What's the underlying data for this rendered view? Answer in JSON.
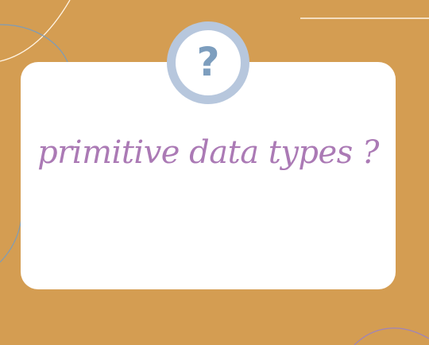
{
  "card": {
    "headline": "primitive data types ?",
    "badge_glyph": "?",
    "badge_icon": "question-mark-icon"
  },
  "colors": {
    "background": "#d49d52",
    "card": "#ffffff",
    "headline": "#ab7ab5",
    "badge_ring": "#b7c7dd",
    "badge_glyph": "#7d9ebe",
    "line_white": "#fff4e4",
    "line_blue": "#7f9cb6",
    "line_purple": "#9e84bb"
  }
}
